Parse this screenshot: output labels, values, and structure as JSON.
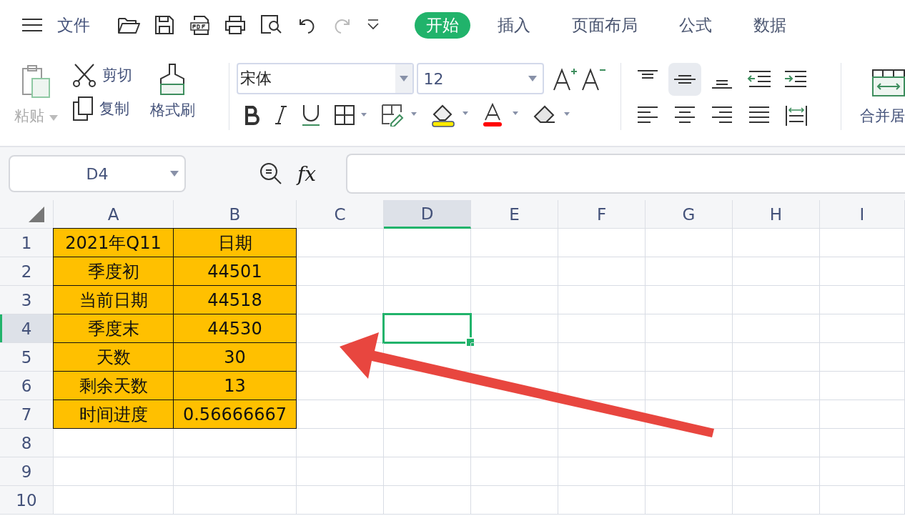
{
  "menu": {
    "file_label": "文件"
  },
  "quick_access": [
    {
      "kind": "open",
      "disabled": false
    },
    {
      "kind": "save",
      "disabled": false
    },
    {
      "kind": "pdf",
      "disabled": false
    },
    {
      "kind": "print",
      "disabled": false
    },
    {
      "kind": "preview",
      "disabled": false
    },
    {
      "kind": "undo",
      "disabled": false
    },
    {
      "kind": "redo",
      "disabled": true
    },
    {
      "kind": "more",
      "disabled": false
    }
  ],
  "tabs": [
    {
      "label": "开始",
      "selected": true
    },
    {
      "label": "插入",
      "selected": false
    },
    {
      "label": "页面布局",
      "selected": false
    },
    {
      "label": "公式",
      "selected": false
    },
    {
      "label": "数据",
      "selected": false
    }
  ],
  "clipboard": {
    "paste": {
      "label": "粘贴",
      "disabled": true
    },
    "cut": "剪切",
    "copy": "复制",
    "format_painter": "格式刷"
  },
  "font": {
    "name": "宋体",
    "size": "12"
  },
  "align_buttons": [
    {
      "kind": "top",
      "selected": false
    },
    {
      "kind": "middle",
      "selected": true
    },
    {
      "kind": "bottom",
      "selected": false
    },
    {
      "kind": "outdent",
      "selected": false
    },
    {
      "kind": "indent",
      "selected": false
    },
    {
      "kind": "left",
      "selected": false
    },
    {
      "kind": "center",
      "selected": false
    },
    {
      "kind": "right",
      "selected": false
    },
    {
      "kind": "justify",
      "selected": false
    },
    {
      "kind": "distributed",
      "selected": false
    }
  ],
  "merge": {
    "label": "合并居"
  },
  "name_box": {
    "value": "D4"
  },
  "formula_bar": {
    "function_label": "fx"
  },
  "columns": [
    {
      "label": "A",
      "selected": false
    },
    {
      "label": "B",
      "selected": false
    },
    {
      "label": "C",
      "selected": false
    },
    {
      "label": "D",
      "selected": true
    },
    {
      "label": "E",
      "selected": false
    },
    {
      "label": "F",
      "selected": false
    },
    {
      "label": "G",
      "selected": false
    },
    {
      "label": "H",
      "selected": false
    },
    {
      "label": "I",
      "selected": false
    }
  ],
  "rows": [
    {
      "label": "1",
      "selected": false,
      "cells": [
        "2021年Q11",
        "日期"
      ]
    },
    {
      "label": "2",
      "selected": false,
      "cells": [
        "季度初",
        "44501"
      ]
    },
    {
      "label": "3",
      "selected": false,
      "cells": [
        "当前日期",
        "44518"
      ]
    },
    {
      "label": "4",
      "selected": true,
      "cells": [
        "季度末",
        "44530"
      ]
    },
    {
      "label": "5",
      "selected": false,
      "cells": [
        "天数",
        "30"
      ]
    },
    {
      "label": "6",
      "selected": false,
      "cells": [
        "剩余天数",
        "13"
      ]
    },
    {
      "label": "7",
      "selected": false,
      "cells": [
        "时间进度",
        "0.56666667"
      ]
    },
    {
      "label": "8",
      "selected": false
    },
    {
      "label": "9",
      "selected": false
    },
    {
      "label": "10",
      "selected": false
    }
  ]
}
